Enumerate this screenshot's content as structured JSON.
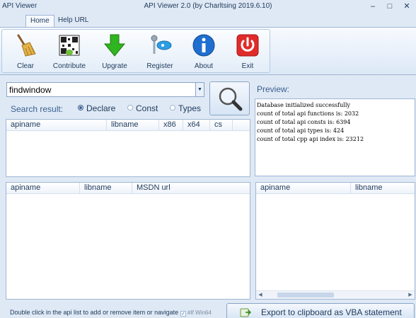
{
  "window": {
    "app_label": "API Viewer",
    "title": "API Viewer 2.0 (by Charltsing 2019.6.10)",
    "minimize": "–",
    "maximize": "□",
    "close": "✕"
  },
  "tabs": [
    {
      "label": "Home",
      "active": true
    },
    {
      "label": "Help URL",
      "active": false
    }
  ],
  "toolbar": {
    "buttons": [
      {
        "label": "Clear",
        "icon": "broom-icon"
      },
      {
        "label": "Contribute",
        "icon": "qr-code-icon"
      },
      {
        "label": "Upgrate",
        "icon": "download-arrow-icon"
      },
      {
        "label": "Register",
        "icon": "key-icon"
      },
      {
        "label": "About",
        "icon": "info-icon"
      },
      {
        "label": "Exit",
        "icon": "power-icon"
      }
    ]
  },
  "search": {
    "value": "findwindow",
    "label": "Search result:",
    "options": [
      {
        "label": "Declare",
        "selected": true
      },
      {
        "label": "Const",
        "selected": false
      },
      {
        "label": "Types",
        "selected": false
      }
    ]
  },
  "preview": {
    "label": "Preview:",
    "lines": [
      "Database initialized successfully",
      "count of total api functions is: 2032",
      "count of total api consts is: 6394",
      "count of total api types is: 424",
      "count of total cpp api index is: 23212"
    ]
  },
  "results_table": {
    "columns": [
      "apiname",
      "libname",
      "x86",
      "x64",
      "cs"
    ]
  },
  "list_table": {
    "columns": [
      "apiname",
      "libname",
      "MSDN url"
    ]
  },
  "right_table": {
    "columns": [
      "apiname",
      "libname"
    ]
  },
  "footer": {
    "hint": "Double click in the api list to add or remove item or navigate",
    "checkbox_label": "#If Win64",
    "export_label": "Export to clipboard as VBA statement"
  },
  "colors": {
    "accent": "#1e395b",
    "frame": "#dfe9f5",
    "border": "#9fb6d4"
  }
}
